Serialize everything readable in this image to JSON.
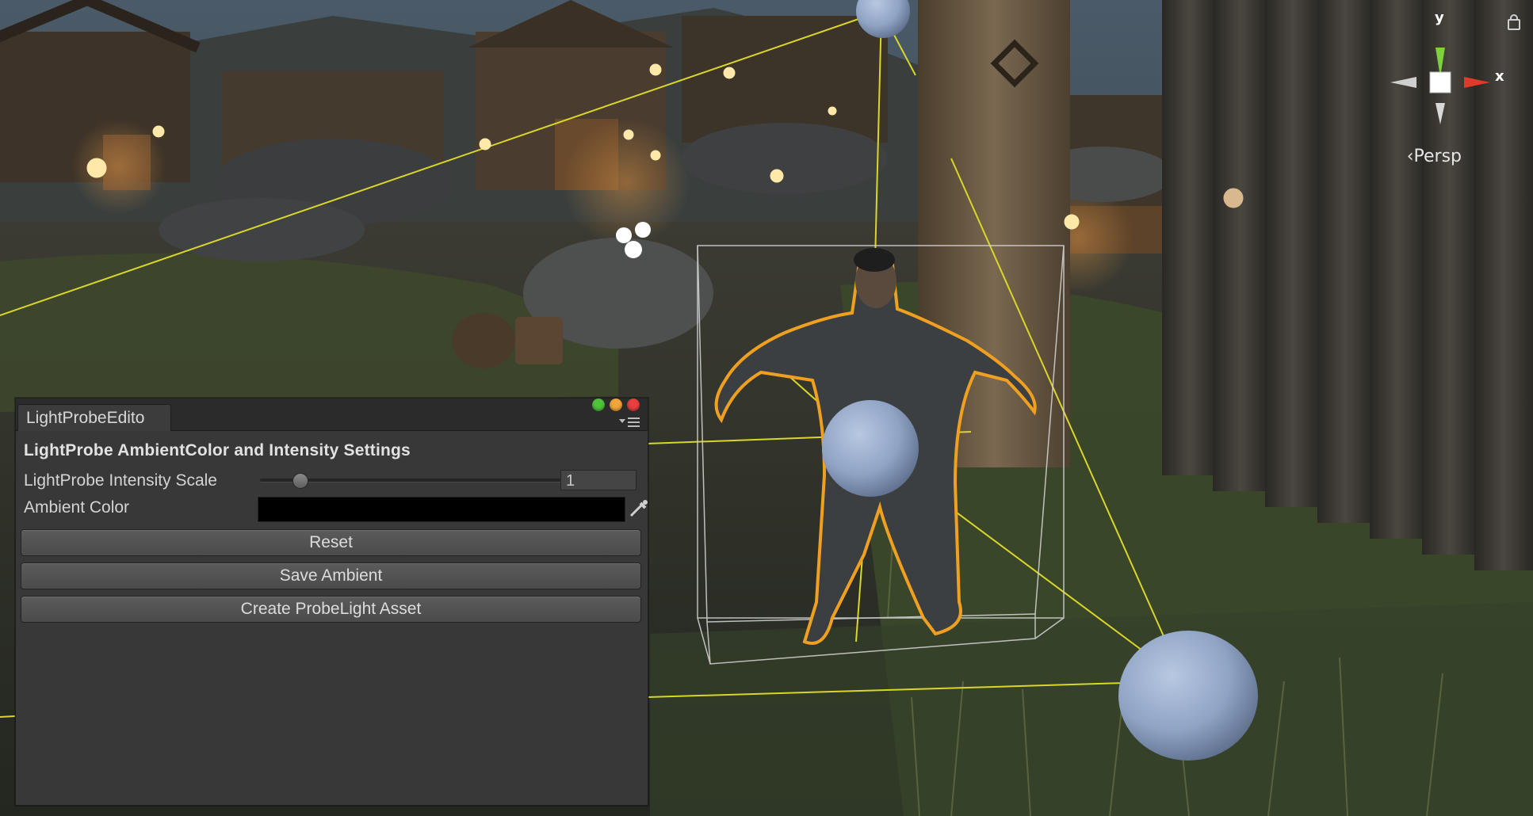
{
  "viewport": {
    "camera_mode": "Persp",
    "gizmo_axes": {
      "y": "y",
      "x": "x"
    }
  },
  "editor": {
    "tab_title": "LightProbeEdito",
    "window_controls": [
      "green-dot",
      "yellow-dot",
      "red-dot"
    ],
    "heading": "LightProbe AmbientColor and Intensity Settings",
    "intensity": {
      "label": "LightProbe Intensity Scale",
      "value": "1",
      "slider_fraction": 0.13
    },
    "ambient": {
      "label": "Ambient Color",
      "color": "#000000"
    },
    "buttons": {
      "reset": "Reset",
      "save": "Save Ambient",
      "create": "Create ProbeLight Asset"
    }
  },
  "colors": {
    "selection_outline": "#f0a020",
    "probe_lines": "#d9d62a",
    "probe_sphere": "#8fa3c4",
    "axis_x": "#e03a2a",
    "axis_y": "#7dd13a"
  }
}
